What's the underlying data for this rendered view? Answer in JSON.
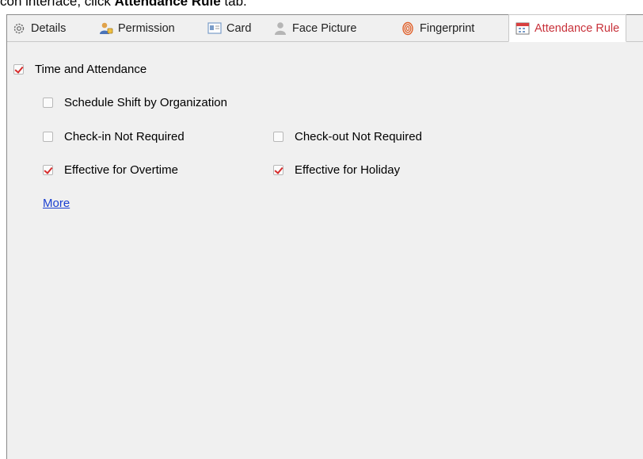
{
  "caption": {
    "text_before": "con interface, click ",
    "bold": "Attendance Rule",
    "text_after": " tab."
  },
  "tabs": [
    {
      "label": "Details",
      "icon": "gear-icon"
    },
    {
      "label": "Permission",
      "icon": "user-permission-icon"
    },
    {
      "label": "Card",
      "icon": "card-icon"
    },
    {
      "label": "Face Picture",
      "icon": "person-icon"
    },
    {
      "label": "Fingerprint",
      "icon": "fingerprint-icon"
    },
    {
      "label": "Attendance Rule",
      "icon": "calendar-icon",
      "active": true
    }
  ],
  "options": {
    "time_attendance": {
      "label": "Time and Attendance",
      "checked": true
    },
    "schedule_shift": {
      "label": "Schedule Shift by Organization",
      "checked": false
    },
    "checkin_not_required": {
      "label": "Check-in Not Required",
      "checked": false
    },
    "checkout_not_required": {
      "label": "Check-out Not Required",
      "checked": false
    },
    "effective_overtime": {
      "label": "Effective for Overtime",
      "checked": true
    },
    "effective_holiday": {
      "label": "Effective for Holiday",
      "checked": true
    }
  },
  "more_link": "More",
  "colors": {
    "active_tab_text": "#c8313a",
    "checkmark": "#d62b2b",
    "link": "#1a3fd0",
    "panel_bg": "#f0f0f0"
  }
}
